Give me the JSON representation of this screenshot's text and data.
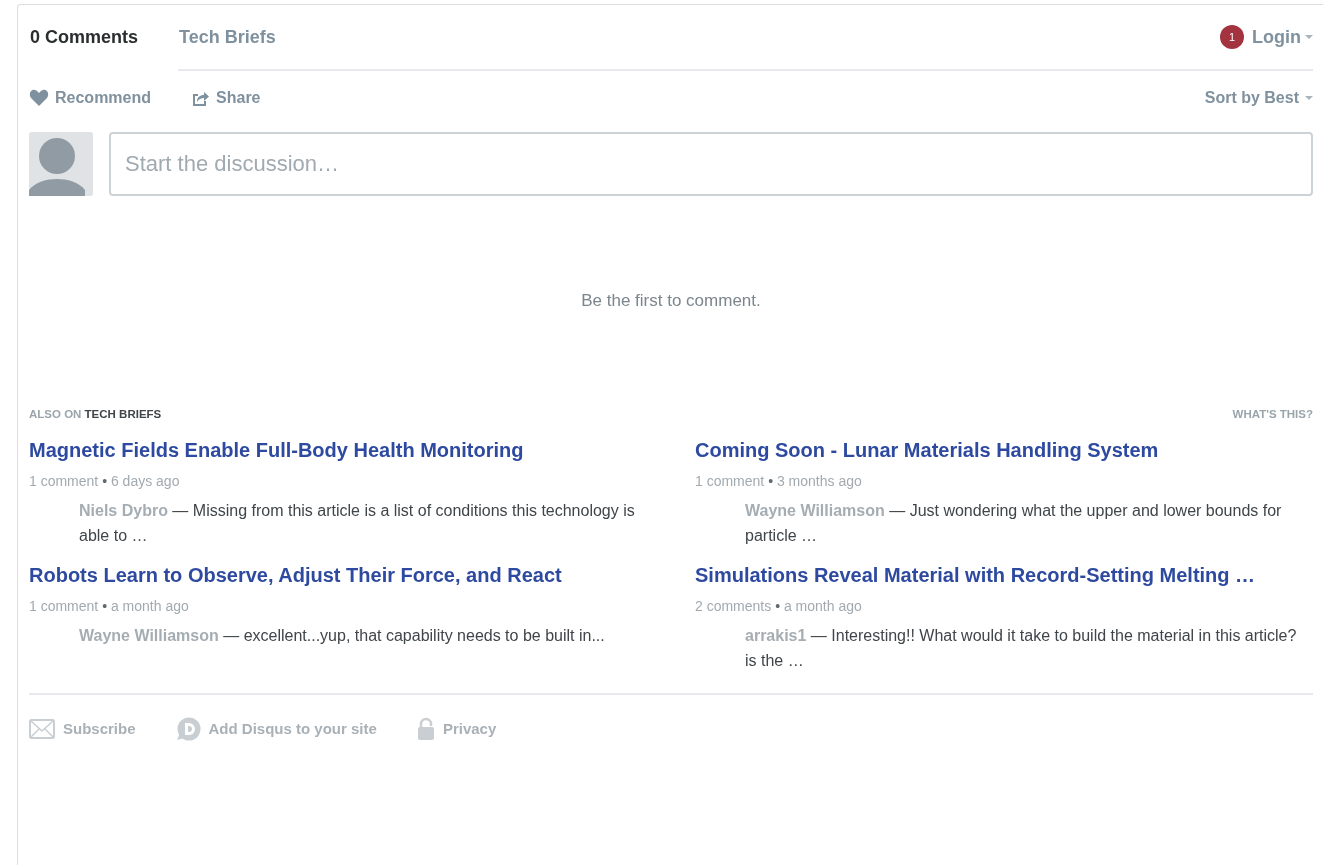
{
  "tabs": [
    {
      "label": "0 Comments",
      "selected": true
    },
    {
      "label": "Tech Briefs",
      "selected": false
    }
  ],
  "notifications": {
    "count": "1"
  },
  "login": {
    "label": "Login"
  },
  "actions": [
    {
      "kind": "recommend",
      "label": "Recommend"
    },
    {
      "kind": "share",
      "label": "Share"
    }
  ],
  "sort": {
    "label": "Sort by Best"
  },
  "composer": {
    "placeholder": "Start the discussion…"
  },
  "empty_message": "Be the first to comment.",
  "also_on": {
    "prefix": "ALSO ON",
    "site": "TECH BRIEFS",
    "whats_this": "WHAT'S THIS?"
  },
  "articles": [
    {
      "title": "Magnetic Fields Enable Full-Body Health Monitoring",
      "comments": "1 comment",
      "separator": "•",
      "age": "6 days ago",
      "excerpt": "**Niels Dybro** — Missing from this article is a list of conditions this technology is able to …"
    },
    {
      "title": "Coming Soon - Lunar Materials Handling System",
      "comments": "1 comment",
      "separator": "•",
      "age": "3 months ago",
      "excerpt": "**Wayne Williamson** — Just wondering what the upper and lower bounds for particle …"
    },
    {
      "title": "Robots Learn to Observe, Adjust Their Force, and React",
      "comments": "1 comment",
      "separator": "•",
      "age": "a month ago",
      "excerpt": "**Wayne Williamson** — excellent...yup, that capability needs to be built in..."
    },
    {
      "title": "Simulations Reveal Material with Record-Setting Melting …",
      "comments": "2 comments",
      "separator": "•",
      "age": "a month ago",
      "excerpt": "**arrakis1** — Interesting!! What would it take to build the material in this article? is the …"
    }
  ],
  "footer": [
    {
      "kind": "subscribe",
      "label": "Subscribe"
    },
    {
      "kind": "disqus",
      "label": "Add Disqus to your site"
    },
    {
      "kind": "privacy",
      "label": "Privacy"
    }
  ]
}
